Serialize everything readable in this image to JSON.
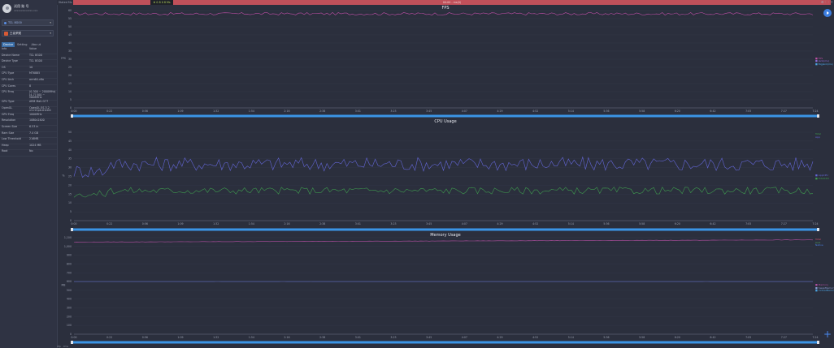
{
  "user": {
    "name": "试用 账 号",
    "sub": "xxxxxxxxxxxxx.xxx"
  },
  "device_select": {
    "label": "TCL 8G00"
  },
  "app_select": {
    "label": "王者荣耀"
  },
  "tabs": [
    "Device",
    "Setting",
    "Abo ut"
  ],
  "properties": {
    "header": [
      "Info",
      "Value"
    ],
    "rows": [
      [
        "Device Name",
        "TCL 8G00"
      ],
      [
        "Device Type",
        "TCL 8G00"
      ],
      [
        "OS",
        "10"
      ],
      [
        "CPU Type",
        "MT6885"
      ],
      [
        "CPU Arch",
        "arm64-v8a"
      ],
      [
        "CPU Cores",
        "8"
      ],
      [
        "CPU Freq",
        "(0-300 ~ 2000MHz) [4-7] 500 ~ 2600MHz"
      ],
      [
        "GPU Type",
        "ARM Mali-G77"
      ],
      [
        "OpenGL",
        "OpenGL ES 3.2 v1.r21p0-01rel0"
      ],
      [
        "GPU Freq",
        "1000MHz"
      ],
      [
        "Resolution",
        "1080x2400"
      ],
      [
        "Screen Size",
        "6.53 in"
      ],
      [
        "Ram Size",
        "7.4 GB"
      ],
      [
        "Low Threshold",
        "216MB"
      ],
      [
        "Heap",
        "1024 MB"
      ],
      [
        "Root",
        "No"
      ]
    ]
  },
  "topbar": {
    "label": "Stated Ms",
    "badge": "♦ 0 8 0 8 Ms",
    "center": "00:00 - ms(0)"
  },
  "time_labels": [
    "0:00",
    "0:22",
    "0:56",
    "1:09",
    "1:32",
    "1:54",
    "2:16",
    "2:38",
    "3:01",
    "3:23",
    "3:45",
    "4:07",
    "4:29",
    "4:52",
    "5:14",
    "5:36",
    "5:58",
    "6:20",
    "6:42",
    "7:05",
    "7:27",
    "7:24"
  ],
  "charts": [
    {
      "title": "FPS",
      "yticks": [
        "60",
        "55",
        "50",
        "45",
        "40",
        "35",
        "30",
        "25",
        "20",
        "15",
        "10",
        "5",
        "0"
      ],
      "ylabel": "FPS",
      "legend": [
        "FPS",
        "Jank(ms)",
        "BigJank(ms)"
      ],
      "legend_colors": [
        "#c04fa8",
        "#8f6ed8",
        "#4aa3e0"
      ]
    },
    {
      "title": "CPU Usage",
      "yticks": [
        "50",
        "45",
        "40",
        "35",
        "30",
        "25",
        "20",
        "15",
        "10",
        "5",
        "0"
      ],
      "ylabel": "%",
      "legend": [
        "AppCPU",
        "TotalCPU"
      ],
      "top_labels": [
        "Total",
        "App"
      ],
      "legend_colors": [
        "#6366d6",
        "#3f9c4f"
      ]
    },
    {
      "title": "Memory Usage",
      "yticks": [
        "1,100",
        "1,000",
        "900",
        "800",
        "700",
        "600",
        "500",
        "400",
        "300",
        "200",
        "100",
        "0"
      ],
      "ylabel": "MB",
      "legend": [
        "Memory",
        "SwapMemory",
        "VirtualMemory"
      ],
      "top_labels": [
        "Total",
        "Java",
        "Native"
      ],
      "legend_colors": [
        "#b34fa2",
        "#8b9fd6",
        "#4aa3e0"
      ]
    }
  ],
  "chart_data": [
    {
      "type": "line",
      "title": "FPS",
      "y": {
        "min": 0,
        "max": 60
      },
      "series": [
        {
          "name": "FPS",
          "approx": 58
        }
      ]
    },
    {
      "type": "line",
      "title": "CPU Usage",
      "y": {
        "min": 0,
        "max": 50
      },
      "series": [
        {
          "name": "TotalCPU",
          "approx": 32
        },
        {
          "name": "AppCPU",
          "approx": 17
        }
      ]
    },
    {
      "type": "line",
      "title": "Memory Usage",
      "y": {
        "min": 0,
        "max": 1100
      },
      "series": [
        {
          "name": "Memory",
          "approx": 1050
        },
        {
          "name": "VirtualMemory",
          "approx": 600
        }
      ]
    }
  ],
  "footer": {
    "text": "0fp · 0ms"
  },
  "colors": {
    "accent": "#3d8ee8",
    "bar": "#c0505a",
    "scroll": "#3b95e6"
  }
}
